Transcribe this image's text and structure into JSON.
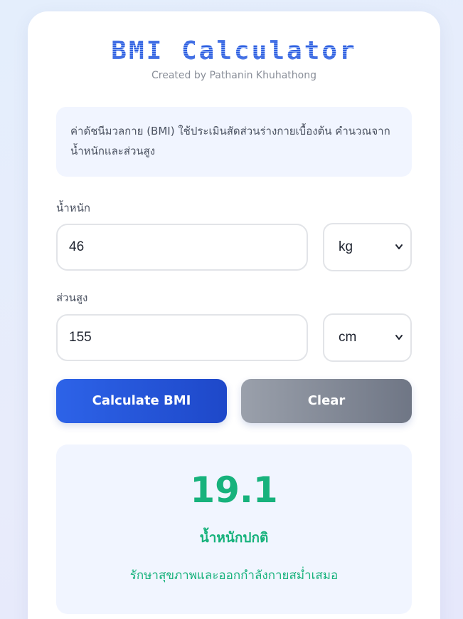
{
  "app": {
    "title": "BMI Calculator",
    "subtitle": "Created by Pathanin Khuhathong"
  },
  "info": {
    "text": "ค่าดัชนีมวลกาย (BMI) ใช้ประเมินสัดส่วนร่างกายเบื้องต้น คำนวณจากน้ำหนักและส่วนสูง"
  },
  "weight": {
    "label": "น้ำหนัก",
    "value": "46",
    "unit": "kg"
  },
  "height": {
    "label": "ส่วนสูง",
    "value": "155",
    "unit": "cm"
  },
  "buttons": {
    "calculate": "Calculate BMI",
    "clear": "Clear"
  },
  "result": {
    "value": "19.1",
    "category": "น้ำหนักปกติ",
    "advice": "รักษาสุขภาพและออกกำลังกายสม่ำเสมอ",
    "color": "#17b27c"
  },
  "colors": {
    "primary": "#2d63e8",
    "secondary": "#6f7685",
    "panel": "#f1f5ff"
  },
  "icons": {
    "unit_select": "chevron-down-icon"
  }
}
